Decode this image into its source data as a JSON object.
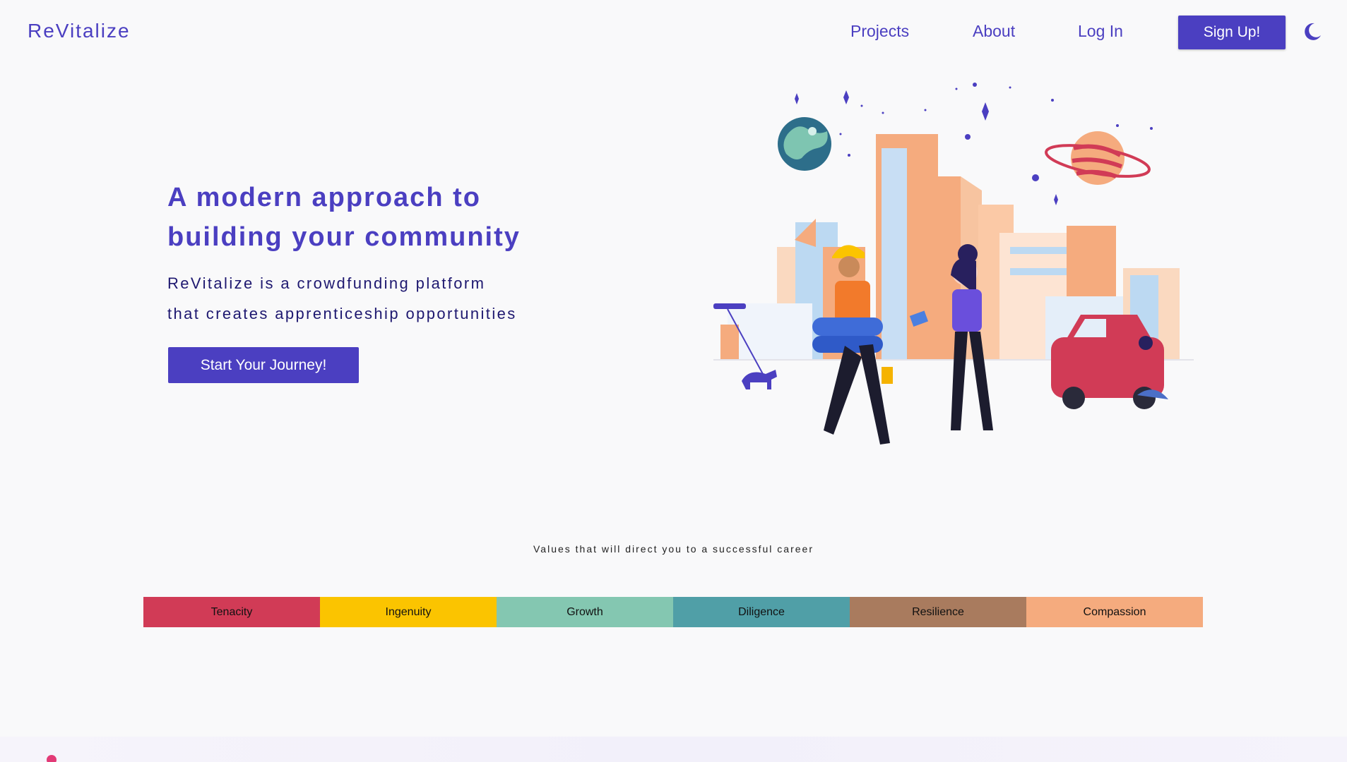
{
  "nav": {
    "brand": "ReVitalize",
    "links": [
      "Projects",
      "About",
      "Log In"
    ],
    "signup_label": "Sign Up!",
    "theme_toggle_icon": "moon-icon"
  },
  "hero": {
    "title_line1": "A modern approach to",
    "title_line2": "building your community",
    "subtitle_line1": "ReVitalize is a crowdfunding platform",
    "subtitle_line2": "that creates apprenticeship opportunities",
    "cta_label": "Start Your Journey!"
  },
  "values": {
    "caption": "Values that will direct you to a successful career",
    "items": [
      {
        "label": "Tenacity",
        "color": "#d13b56"
      },
      {
        "label": "Ingenuity",
        "color": "#fbc400"
      },
      {
        "label": "Growth",
        "color": "#84c7b1"
      },
      {
        "label": "Diligence",
        "color": "#509fa7"
      },
      {
        "label": "Resilience",
        "color": "#a97b5e"
      },
      {
        "label": "Compassion",
        "color": "#f5ab7e"
      }
    ]
  },
  "colors": {
    "brand": "#4b3fc1",
    "background": "#f9f9fa"
  }
}
